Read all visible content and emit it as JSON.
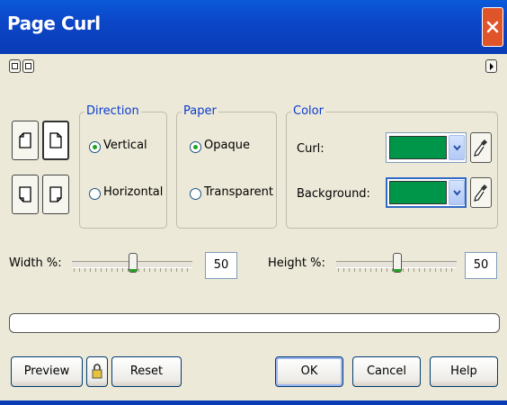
{
  "window": {
    "title": "Page Curl"
  },
  "icons": {
    "close": "close-icon",
    "mini_preview_a": "preview-mode-icon",
    "mini_preview_b": "preview-mode-icon",
    "flyout": "flyout-arrow-icon",
    "lock": "lock-icon",
    "eyedropper": "eyedropper-icon"
  },
  "direction": {
    "legend": "Direction",
    "options": [
      "Vertical",
      "Horizontal"
    ],
    "selected": "Vertical"
  },
  "paper": {
    "legend": "Paper",
    "options": [
      "Opaque",
      "Transparent"
    ],
    "selected": "Opaque"
  },
  "color": {
    "legend": "Color",
    "curl_label": "Curl:",
    "background_label": "Background:",
    "curl_color": "#00964a",
    "background_color": "#00964a"
  },
  "width": {
    "label": "Width %:",
    "value": "50"
  },
  "height": {
    "label": "Height %:",
    "value": "50"
  },
  "buttons": {
    "preview": "Preview",
    "reset": "Reset",
    "ok": "OK",
    "cancel": "Cancel",
    "help": "Help"
  },
  "colors": {
    "title_bar": "#0b46c7",
    "dialog_bg": "#ece9d8",
    "group_legend": "#0a3bd1",
    "selected_radio": "#21a121"
  }
}
